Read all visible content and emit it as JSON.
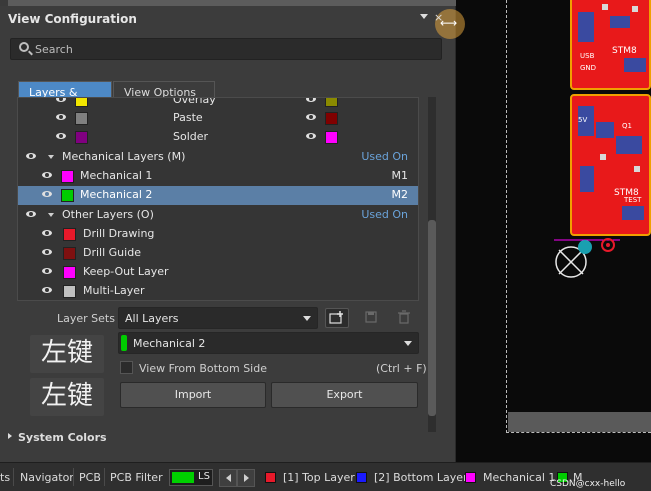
{
  "panel": {
    "title": "View Configuration",
    "close_glyph": "×",
    "resize_glyph": "⟷",
    "header_strip": "Layer & Colors"
  },
  "search": {
    "placeholder": "Search"
  },
  "tabs": [
    {
      "label": "Layers & Colors",
      "active": true
    },
    {
      "label": "View Options",
      "active": false
    }
  ],
  "layers": {
    "top_rows": [
      {
        "label": "Overlay",
        "color_left": "#f2e600",
        "color_right": "#8a8a00"
      },
      {
        "label": "Paste",
        "color_left": "#808080",
        "color_right": "#800000"
      },
      {
        "label": "Solder",
        "color_left": "#800080",
        "color_right": "#ff00ff"
      }
    ],
    "mechanical": {
      "label": "Mechanical Layers (M)",
      "used_on": "Used On",
      "items": [
        {
          "label": "Mechanical 1",
          "color": "#ff00ff",
          "code": "M1",
          "selected": false
        },
        {
          "label": "Mechanical 2",
          "color": "#00cc00",
          "code": "M2",
          "selected": true
        }
      ]
    },
    "other": {
      "label": "Other Layers (O)",
      "used_on": "Used On",
      "items": [
        {
          "label": "Drill Drawing",
          "color": "#e8192a"
        },
        {
          "label": "Drill Guide",
          "color": "#7f1010"
        },
        {
          "label": "Keep-Out Layer",
          "color": "#ff00ff"
        },
        {
          "label": "Multi-Layer",
          "color": "#c0c0c0"
        }
      ]
    }
  },
  "layer_sets": {
    "label": "Layer Sets",
    "value": "All Layers"
  },
  "current_layer": {
    "value": "Mechanical 2",
    "color": "#00cc00"
  },
  "overlay_glyphs": [
    "左键",
    "左键"
  ],
  "view_from_bottom": {
    "label": "View From Bottom Side",
    "shortcut": "(Ctrl + F)"
  },
  "buttons": {
    "import": "Import",
    "export": "Export"
  },
  "system_colors": "System Colors",
  "statusbar": {
    "items": [
      "ts",
      "Navigator",
      "PCB",
      "PCB Filter"
    ],
    "ls_label": "LS",
    "layers": [
      {
        "label": "[1] Top Layer",
        "color": "#e8192a"
      },
      {
        "label": "[2] Bottom Layer",
        "color": "#1a1aff"
      },
      {
        "label": "Mechanical 1",
        "color": "#ff00ff"
      },
      {
        "label": "M",
        "color": "#00cc00"
      }
    ],
    "watermark": "CSDN@cxx-hello"
  },
  "canvas_labels": [
    "STM8",
    "STM8",
    "USB",
    "GND",
    "Q1",
    "TEST",
    "5V"
  ]
}
